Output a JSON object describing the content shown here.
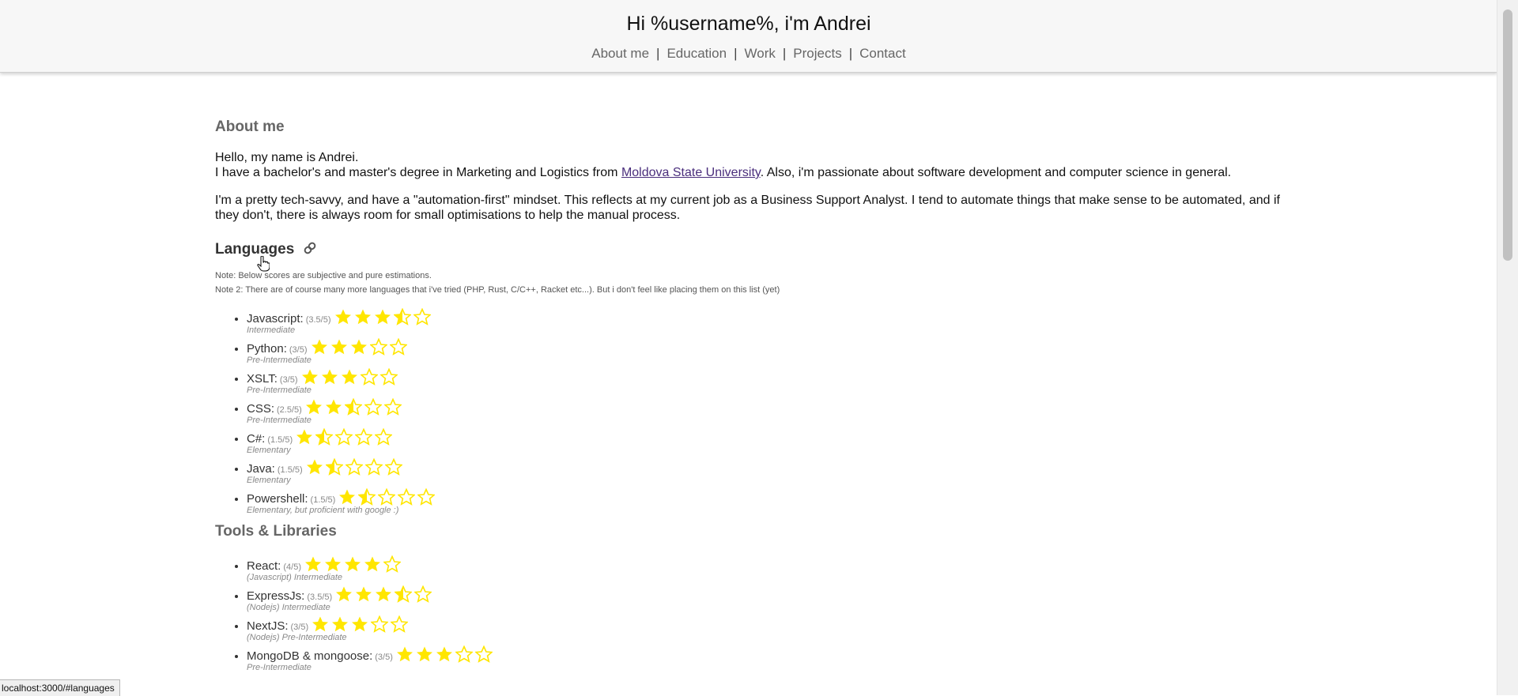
{
  "header": {
    "title": "Hi %username%, i'm Andrei",
    "nav": [
      "About me",
      "Education",
      "Work",
      "Projects",
      "Contact"
    ],
    "separator": "|"
  },
  "about": {
    "heading": "About me",
    "p1_line1": "Hello, my name is Andrei.",
    "p1_line2_before": "I have a bachelor's and master's degree in Marketing and Logistics from ",
    "p1_link": "Moldova State University",
    "p1_line2_after": ". Also, i'm passionate about software development and computer science in general.",
    "p2": "I'm a pretty tech-savvy, and have a \"automation-first\" mindset. This reflects at my current job as a Business Support Analyst. I tend to automate things that make sense to be automated, and if they don't, there is always room for small optimisations to help the manual process."
  },
  "languages": {
    "heading": "Languages",
    "icon": "link-icon",
    "note1": "Note: Below scores are subjective and pure estimations.",
    "note2": "Note 2: There are of course many more languages that i've tried (PHP, Rust, C/C++, Racket etc...). But i don't feel like placing them on this list (yet)",
    "items": [
      {
        "name": "Javascript:",
        "score": "(3.5/5)",
        "rating": 3.5,
        "level": "Intermediate"
      },
      {
        "name": "Python:",
        "score": "(3/5)",
        "rating": 3,
        "level": "Pre-Intermediate"
      },
      {
        "name": "XSLT:",
        "score": "(3/5)",
        "rating": 3,
        "level": "Pre-Intermediate"
      },
      {
        "name": "CSS:",
        "score": "(2.5/5)",
        "rating": 2.5,
        "level": "Pre-Intermediate"
      },
      {
        "name": "C#:",
        "score": "(1.5/5)",
        "rating": 1.5,
        "level": "Elementary"
      },
      {
        "name": "Java:",
        "score": "(1.5/5)",
        "rating": 1.5,
        "level": "Elementary"
      },
      {
        "name": "Powershell:",
        "score": "(1.5/5)",
        "rating": 1.5,
        "level": "Elementary, but proficient with google :)"
      }
    ]
  },
  "tools": {
    "heading": "Tools & Libraries",
    "items": [
      {
        "name": "React:",
        "score": "(4/5)",
        "rating": 4,
        "level": "(Javascript) Intermediate"
      },
      {
        "name": "ExpressJs:",
        "score": "(3.5/5)",
        "rating": 3.5,
        "level": "(Nodejs) Intermediate"
      },
      {
        "name": "NextJS:",
        "score": "(3/5)",
        "rating": 3,
        "level": "(Nodejs) Pre-Intermediate"
      },
      {
        "name": "MongoDB & mongoose:",
        "score": "(3/5)",
        "rating": 3,
        "level": "Pre-Intermediate"
      }
    ]
  },
  "status_url": "localhost:3000/#languages",
  "colors": {
    "star": "#ffe600",
    "header_bg": "#f7f7f7",
    "link": "#4a2e7c"
  }
}
